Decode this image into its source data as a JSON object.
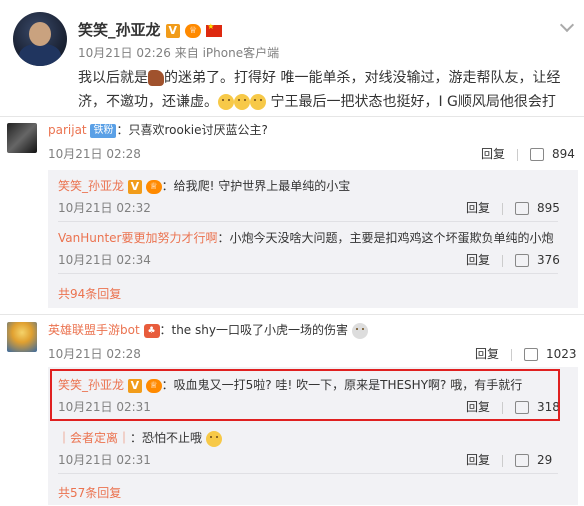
{
  "post": {
    "author": "笑笑_孙亚龙",
    "time": "10月21日 02:26",
    "source": "来自 iPhone客户端",
    "text_line1": "我以后就是",
    "text_line1b": "的迷弟了。打得好 唯一能单杀，对线没输过，游走帮队友，让经",
    "text_line2a": "济，不邀功，还谦虚。",
    "text_line2b": "宁王最后一把状态也挺好，I G顺风局他很会打"
  },
  "comments": [
    {
      "user": "parijat",
      "badge": "铁粉",
      "text": "：只喜欢rookie讨厌蓝公主?",
      "time": "10月21日 02:28",
      "reply_label": "回复",
      "likes": "894",
      "replies": [
        {
          "user": "笑笑_孙亚龙",
          "text": "：给我爬! 守护世界上最单纯的小宝",
          "time": "10月21日 02:32",
          "reply_label": "回复",
          "likes": "895"
        },
        {
          "user": "VanHunter要更加努力才行啊",
          "text": "：小炮今天没啥大问题，主要是扣鸡鸡这个坏蛋欺负单纯的小炮",
          "time": "10月21日 02:34",
          "reply_label": "回复",
          "likes": "376"
        }
      ],
      "more_label": "共94条回复"
    },
    {
      "user": "英雄联盟手游bot",
      "text": "：the shy一口吸了小虎一场的伤害",
      "time": "10月21日 02:28",
      "reply_label": "回复",
      "likes": "1023",
      "replies": [
        {
          "user": "笑笑_孙亚龙",
          "text": "：吸血鬼又一打5啦? 哇! 吹一下，原来是THESHY啊? 哦，有手就行",
          "time": "10月21日 02:31",
          "reply_label": "回复",
          "likes": "318"
        },
        {
          "user": "｜会者定离｜",
          "text": "：恐怕不止哦",
          "time": "10月21日 02:31",
          "reply_label": "回复",
          "likes": "29"
        }
      ],
      "more_label": "共57条回复"
    }
  ],
  "colors": {
    "username": "#eb7350",
    "highlight_border": "#e02020",
    "sub_background": "#f2f2f5"
  }
}
